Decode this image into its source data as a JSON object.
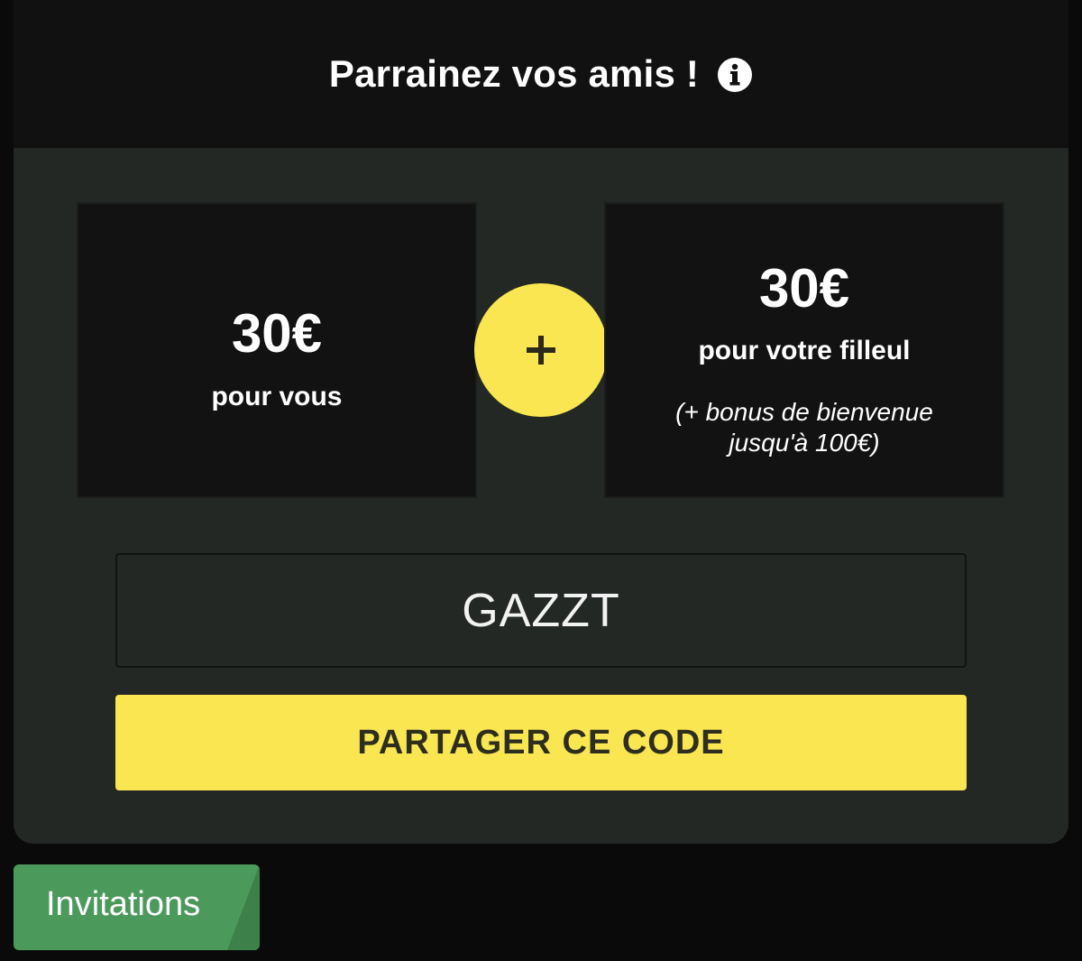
{
  "header": {
    "title": "Parrainez vos amis !",
    "info_icon": "info-circle-icon"
  },
  "rewards": {
    "you": {
      "amount": "30€",
      "label": "pour vous"
    },
    "plus_icon": "plus-icon",
    "referee": {
      "amount": "30€",
      "label": "pour votre filleul",
      "bonus_line1": "(+ bonus de bienvenue",
      "bonus_line2": "jusqu'à 100€)"
    }
  },
  "referral": {
    "code": "GAZZT",
    "share_label": "PARTAGER CE CODE"
  },
  "tabs": {
    "invitations_label": "Invitations"
  },
  "colors": {
    "accent_yellow": "#f9e650",
    "card_background": "#232825",
    "header_background": "#111111",
    "box_background": "#121212",
    "tab_green": "#4b9a5b"
  }
}
